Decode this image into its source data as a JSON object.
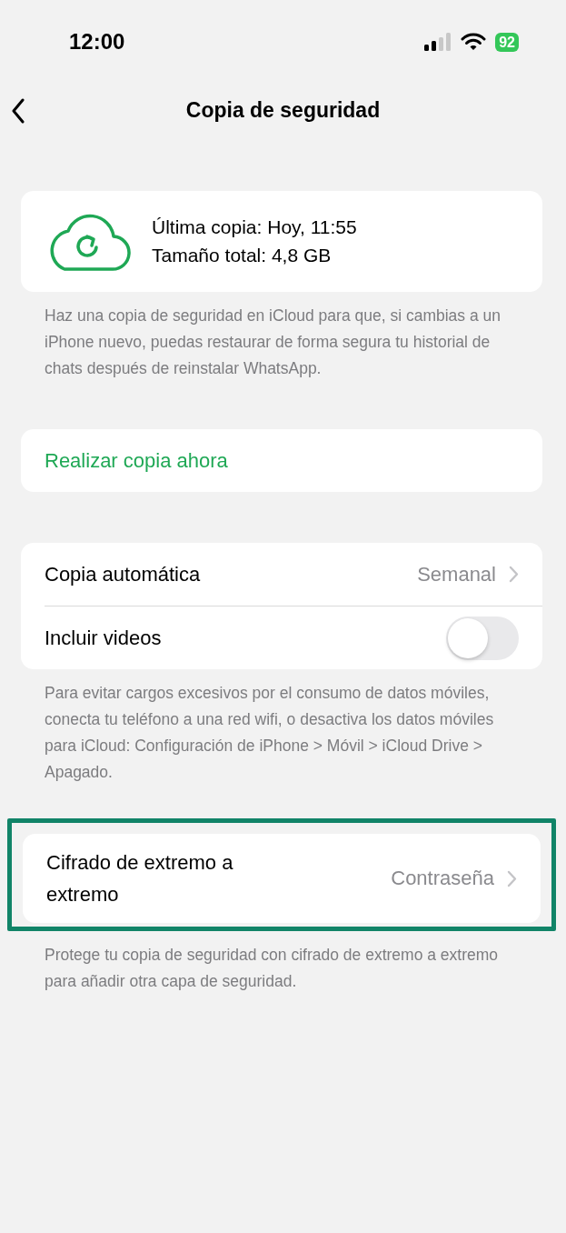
{
  "status_bar": {
    "time": "12:00",
    "battery": "92"
  },
  "nav": {
    "title": "Copia de seguridad"
  },
  "backup_info": {
    "lines": [
      "Última copia: Hoy, 11:55",
      "Tamaño total: 4,8 GB"
    ],
    "footer": "Haz una copia de seguridad en iCloud para que, si cambias a un iPhone nuevo, puedas restaurar de forma segura tu historial de chats después de reinstalar WhatsApp."
  },
  "action": {
    "label": "Realizar copia ahora"
  },
  "settings": {
    "rows": [
      {
        "kind": "value",
        "label": "Copia automática",
        "value": "Semanal"
      },
      {
        "kind": "toggle",
        "label": "Incluir videos",
        "on": false
      }
    ],
    "footer": "Para evitar cargos excesivos por el consumo de datos móviles, conecta tu teléfono a una red wifi, o desactiva los datos móviles para iCloud: Configuración de iPhone > Móvil > iCloud Drive > Apagado."
  },
  "encryption": {
    "highlighted": true,
    "label": "Cifrado de extremo a extremo",
    "value": "Contraseña",
    "footer": "Protege tu copia de seguridad con cifrado de extremo a extremo para añadir otra capa de seguridad."
  }
}
